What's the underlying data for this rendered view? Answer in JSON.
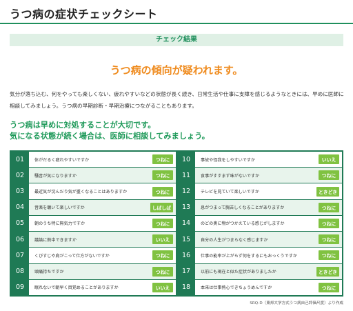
{
  "page": {
    "title": "うつ病の症状チェックシート",
    "result_label": "チェック結果",
    "headline": "うつ病の傾向が疑われます。",
    "body_text": "気分が落ち込む、何をやっても楽しくない、疲れやすいなどの状態が長く続き、日常生活や仕事に支障を感じるようなときには、早めに医師に相談してみましょう。うつ病の早期診断・早期治療につながることもあります。",
    "advice_line1": "うつ病は早めに対処することが大切です。",
    "advice_line2": "気になる状態が続く場合は、医師に相談してみましょう。",
    "source": "SRQ-D（東邦大学方式うつ病自己評価尺度）より作成"
  },
  "colors": {
    "accent_green": "#1f8f5c",
    "table_border": "#1f7a55",
    "answer_badge": "#80c241",
    "headline_orange": "#ef8a1c",
    "row_tint": "#e8f4ec"
  },
  "left_items": [
    {
      "num": "01",
      "question": "体がだるく疲れやすいですか",
      "answer": "つねに"
    },
    {
      "num": "02",
      "question": "騒音が気になりますか",
      "answer": "つねに"
    },
    {
      "num": "03",
      "question": "最近気が沈んだり気が重くなることはありますか",
      "answer": "つねに"
    },
    {
      "num": "04",
      "question": "音楽を聴いて楽しいですか",
      "answer": "しばしば"
    },
    {
      "num": "05",
      "question": "朝のうち特に無気力ですか",
      "answer": "つねに"
    },
    {
      "num": "06",
      "question": "議論に熱中できますか",
      "answer": "いいえ"
    },
    {
      "num": "07",
      "question": "くびすじや肩がこって仕方がないですか",
      "answer": "つねに"
    },
    {
      "num": "08",
      "question": "頭痛持ちですか",
      "answer": "つねに"
    },
    {
      "num": "09",
      "question": "眠れないで朝早く目覚めることがありますか",
      "answer": "いいえ"
    }
  ],
  "right_items": [
    {
      "num": "10",
      "question": "事故や怪我をしやすいですか",
      "answer": "いいえ"
    },
    {
      "num": "11",
      "question": "食事がすすまず味がないですか",
      "answer": "つねに"
    },
    {
      "num": "12",
      "question": "テレビを見ていて楽しいですか",
      "answer": "ときどき"
    },
    {
      "num": "13",
      "question": "息がつまって胸苦しくなることがありますか",
      "answer": "つねに"
    },
    {
      "num": "14",
      "question": "のどの奥に物がつかえている感じがしますか",
      "answer": "つねに"
    },
    {
      "num": "15",
      "question": "自分の人生がつまらなく感じますか",
      "answer": "つねに"
    },
    {
      "num": "16",
      "question": "仕事の能率が上がらず何をするにもおっくうですか",
      "answer": "つねに"
    },
    {
      "num": "17",
      "question": "以前にも現在と似た症状がありましたか",
      "answer": "ときどき"
    },
    {
      "num": "18",
      "question": "本来は仕事熱心できちょうめんですか",
      "answer": "つねに"
    }
  ]
}
